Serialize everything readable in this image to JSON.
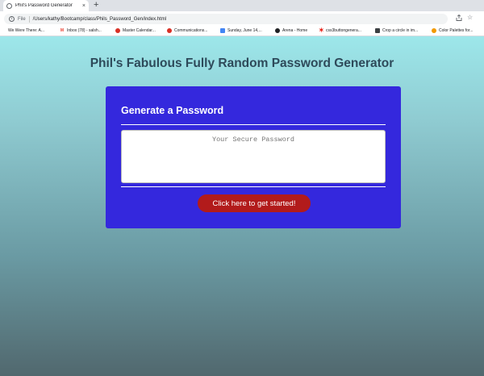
{
  "browser": {
    "tab": {
      "title": "Phil's Password Generator",
      "close": "×"
    },
    "new_tab": "+",
    "address": {
      "scheme": "File",
      "url": "/Users/kathy/Bootcamp/class/Phils_Password_Gen/index.html"
    },
    "bookmarks": [
      {
        "label": "We Were There: A...",
        "icon": "none",
        "color": "#ffffff"
      },
      {
        "label": "Inbox (78) - salsh...",
        "icon": "gmail-icon",
        "color": "#ea4335"
      },
      {
        "label": "Master Calendar...",
        "icon": "calendar-icon",
        "color": "#d93025"
      },
      {
        "label": "Communications...",
        "icon": "communications-icon",
        "color": "#d93025"
      },
      {
        "label": "Sunday, June 14,...",
        "icon": "docs-icon",
        "color": "#4285f4"
      },
      {
        "label": "Arena - Home",
        "icon": "arena-icon",
        "color": "#202124"
      },
      {
        "label": "css3buttongenera...",
        "icon": "star-icon",
        "color": "#e8231a"
      },
      {
        "label": "Crop a circle in im...",
        "icon": "crop-icon",
        "color": "#3c4043"
      },
      {
        "label": "Color Palettes for...",
        "icon": "palette-icon",
        "color": "#f29900"
      }
    ]
  },
  "page": {
    "title": "Phil's Fabulous Fully Random Password Generator",
    "card": {
      "header": "Generate a Password",
      "password_placeholder": "Your Secure Password",
      "button_label": "Click here to get started!"
    }
  },
  "colors": {
    "card_background": "#3428dd",
    "button_background": "#b21b1b",
    "title_text": "#2e4a5a"
  }
}
